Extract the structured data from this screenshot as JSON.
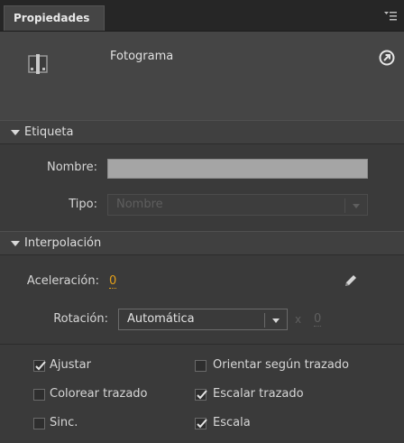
{
  "panel": {
    "tab_label": "Propiedades",
    "frame_label": "Fotograma"
  },
  "etiqueta": {
    "title": "Etiqueta",
    "nombre_label": "Nombre:",
    "nombre_value": "",
    "tipo_label": "Tipo:",
    "tipo_value": "Nombre"
  },
  "interpolacion": {
    "title": "Interpolación",
    "aceleracion_label": "Aceleración:",
    "aceleracion_value": "0",
    "rotacion_label": "Rotación:",
    "rotacion_value": "Automática",
    "times_label": "x",
    "rotacion_count": "0",
    "checkboxes": [
      {
        "label": "Ajustar",
        "checked": true
      },
      {
        "label": "Orientar según trazado",
        "checked": false
      },
      {
        "label": "Colorear trazado",
        "checked": false
      },
      {
        "label": "Escalar trazado",
        "checked": true
      },
      {
        "label": "Sinc.",
        "checked": false
      },
      {
        "label": "Escala",
        "checked": true
      }
    ]
  },
  "colors": {
    "background": "#3a3a3a",
    "accent_orange": "#e5a019",
    "input_gray": "#a5a5a5"
  },
  "icons": {
    "frame": "frame-icon",
    "help": "arrow-circle-icon",
    "menu": "panel-menu-icon",
    "edit": "pencil-icon",
    "disclosure": "triangle-down-icon",
    "check": "checkmark-icon"
  }
}
